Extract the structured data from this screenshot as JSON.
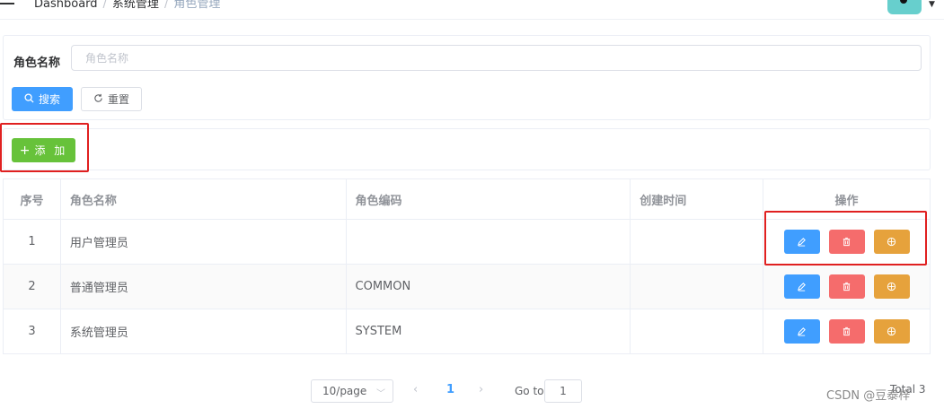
{
  "header": {
    "breadcrumb": [
      "Dashboard",
      "系统管理",
      "角色管理"
    ],
    "separator": "/"
  },
  "search": {
    "label": "角色名称",
    "placeholder": "角色名称",
    "search_button": "搜索",
    "reset_button": "重置"
  },
  "toolbar": {
    "add_button": "添 加"
  },
  "table": {
    "columns": [
      "序号",
      "角色名称",
      "角色编码",
      "创建时间",
      "操作"
    ],
    "rows": [
      {
        "index": "1",
        "name": "用户管理员",
        "code": "",
        "created": ""
      },
      {
        "index": "2",
        "name": "普通管理员",
        "code": "COMMON",
        "created": ""
      },
      {
        "index": "3",
        "name": "系统管理员",
        "code": "SYSTEM",
        "created": ""
      }
    ]
  },
  "pagination": {
    "page_size": "10/page",
    "current_page": "1",
    "goto_label": "Go to",
    "goto_value": "1",
    "total": "Total 3"
  },
  "watermark": "CSDN @豆泰梓",
  "colors": {
    "primary": "#409eff",
    "success": "#67c23a",
    "danger": "#f56c6c",
    "warning": "#e6a23c",
    "highlight": "#e02020"
  },
  "icons": {
    "search": "search-icon",
    "reset": "refresh-icon",
    "add": "plus-icon",
    "edit": "edit-icon",
    "delete": "trash-icon",
    "permission": "target-icon"
  }
}
